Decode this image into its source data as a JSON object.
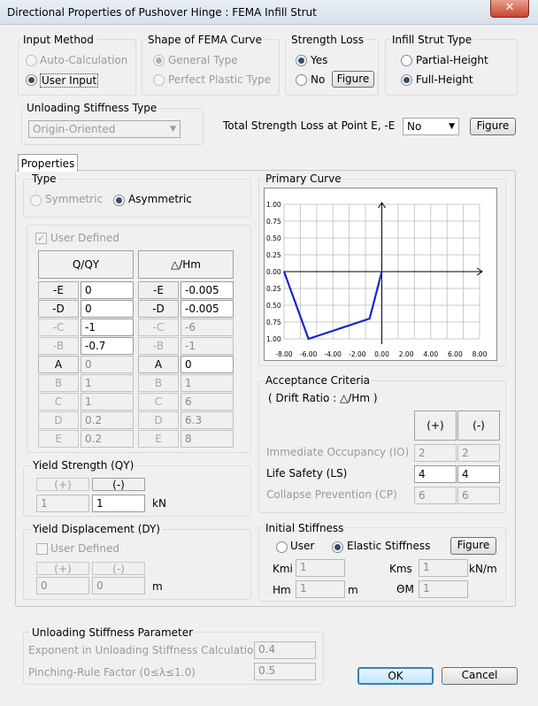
{
  "window": {
    "title": "Directional Properties of Pushover Hinge  : FEMA Infill Strut",
    "close_label": "✕"
  },
  "input_method": {
    "title": "Input Method",
    "options": [
      "Auto-Calculation",
      "User Input"
    ],
    "selected": "User Input"
  },
  "shape": {
    "title": "Shape of FEMA Curve",
    "options": [
      "General Type",
      "Perfect Plastic Type"
    ],
    "selected": "General Type"
  },
  "strength_loss": {
    "title": "Strength Loss",
    "yes": "Yes",
    "no": "No",
    "selected": "Yes",
    "figure_label": "Figure"
  },
  "strut_type": {
    "title": "Infill Strut Type",
    "options": [
      "Partial-Height",
      "Full-Height"
    ],
    "selected": "Full-Height"
  },
  "unloading_type": {
    "title": "Unloading Stiffness Type",
    "value": "Origin-Oriented"
  },
  "total_loss": {
    "label": "Total Strength Loss at Point E, -E",
    "value": "No",
    "figure_label": "Figure"
  },
  "tabs": [
    "Properties"
  ],
  "type": {
    "title": "Type",
    "options": [
      "Symmetric",
      "Asymmetric"
    ],
    "selected": "Asymmetric"
  },
  "table": {
    "user_defined_label": "User Defined",
    "left_header": "Q/QY",
    "right_header": "△/Hm",
    "rows": [
      {
        "label": "-E",
        "q": "0",
        "d": "-0.005",
        "enabled": true
      },
      {
        "label": "-D",
        "q": "0",
        "d": "-0.005",
        "enabled": true
      },
      {
        "label": "-C",
        "q": "-1",
        "d": "-6",
        "enabled": false
      },
      {
        "label": "-B",
        "q": "-0.7",
        "d": "-1",
        "enabled": false
      },
      {
        "label": "A",
        "q": "0",
        "d": "0",
        "enabled": true
      },
      {
        "label": "B",
        "q": "1",
        "d": "1",
        "enabled": false
      },
      {
        "label": "C",
        "q": "1",
        "d": "6",
        "enabled": false
      },
      {
        "label": "D",
        "q": "0.2",
        "d": "6.3",
        "enabled": false
      },
      {
        "label": "E",
        "q": "0.2",
        "d": "8",
        "enabled": false
      }
    ],
    "q_editable": [
      true,
      true,
      true,
      true,
      false,
      false,
      false,
      false,
      false
    ],
    "d_editable": [
      true,
      true,
      false,
      false,
      true,
      false,
      false,
      false,
      false
    ]
  },
  "yield_strength": {
    "title": "Yield Strength (QY)",
    "plus": "(+)",
    "minus": "(-)",
    "plus_value": "1",
    "minus_value": "1",
    "unit": "kN"
  },
  "yield_disp": {
    "title": "Yield Displacement (DY)",
    "user_defined": "User Defined",
    "plus": "(+)",
    "minus": "(-)",
    "plus_value": "0",
    "minus_value": "0",
    "unit": "m"
  },
  "primary_curve": {
    "title": "Primary Curve"
  },
  "chart_data": {
    "type": "line",
    "x_ticks": [
      "-8.00",
      "-6.00",
      "-4.00",
      "-2.00",
      "0.00",
      "2.00",
      "4.00",
      "6.00",
      "8.00"
    ],
    "y_ticks": [
      "1.00",
      "0.75",
      "0.50",
      "0.25",
      "0.00",
      "-0.25",
      "-0.50",
      "-0.75",
      "-1.00"
    ],
    "y_tick_display": [
      "1.00",
      "0.75",
      "0.50",
      "0.25",
      "0.00",
      "0.25",
      "0.50",
      "0.75",
      "1.00"
    ],
    "xlim": [
      -8,
      8
    ],
    "ylim": [
      -1,
      1
    ],
    "grid": true,
    "series": [
      {
        "x": [
          -8,
          -6,
          -1,
          0,
          0
        ],
        "y": [
          0,
          -1,
          -0.7,
          0,
          0
        ]
      }
    ],
    "color": "#1a24c8"
  },
  "acceptance": {
    "title": "Acceptance Criteria",
    "subtitle": "( Drift Ratio : △/Hm )",
    "plus": "(+)",
    "minus": "(-)",
    "rows": [
      {
        "label": "Immediate Occupancy (IO)",
        "plus": "2",
        "minus": "2",
        "enabled": false
      },
      {
        "label": "Life Safety (LS)",
        "plus": "4",
        "minus": "4",
        "enabled": true
      },
      {
        "label": "Collapse Prevention (CP)",
        "plus": "6",
        "minus": "6",
        "enabled": false
      }
    ]
  },
  "initial_stiffness": {
    "title": "Initial Stiffness",
    "user": "User",
    "elastic": "Elastic Stiffness",
    "selected": "Elastic Stiffness",
    "figure_label": "Figure",
    "kmi_label": "Kmi",
    "kmi_value": "1",
    "kms_label": "Kms",
    "kms_value": "1",
    "kms_unit": "kN/m",
    "hm_label": "Hm",
    "hm_value": "1",
    "hm_unit": "m",
    "theta_label": "ΘM",
    "theta_value": "1"
  },
  "unloading_param": {
    "title": "Unloading Stiffness Parameter",
    "exponent_label": "Exponent in Unloading Stiffness Calculation",
    "exponent_value": "0.4",
    "pinching_label": "Pinching-Rule Factor (0≤λ≤1.0)",
    "pinching_value": "0.5"
  },
  "buttons": {
    "ok": "OK",
    "cancel": "Cancel"
  }
}
